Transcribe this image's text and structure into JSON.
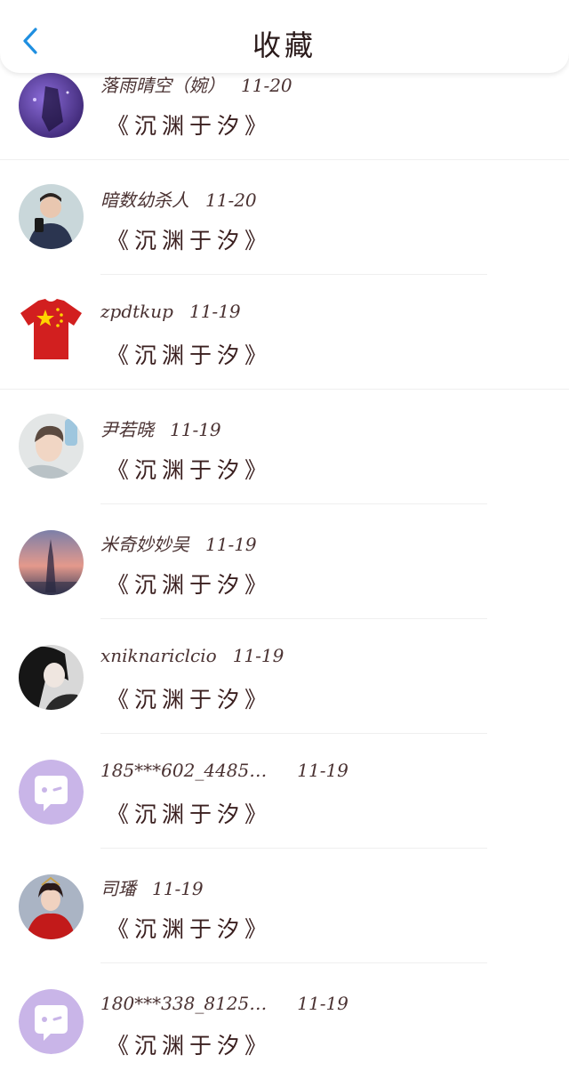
{
  "header": {
    "title": "收藏"
  },
  "items": [
    {
      "name": "落雨晴空（婉）",
      "date": "11-20",
      "work": "《沉渊于汐》",
      "avatar": "photo"
    },
    {
      "name": "暗数幼杀人",
      "date": "11-20",
      "work": "《沉渊于汐》",
      "avatar": "photo"
    },
    {
      "name": "zpdtkup",
      "date": "11-19",
      "work": "《沉渊于汐》",
      "avatar": "flag-shirt"
    },
    {
      "name": "尹若晓",
      "date": "11-19",
      "work": "《沉渊于汐》",
      "avatar": "photo"
    },
    {
      "name": "米奇妙妙吴",
      "date": "11-19",
      "work": "《沉渊于汐》",
      "avatar": "photo"
    },
    {
      "name": "xniknariclcio",
      "date": "11-19",
      "work": "《沉渊于汐》",
      "avatar": "photo"
    },
    {
      "name": "185***602_4485…",
      "date": "11-19",
      "work": "《沉渊于汐》",
      "avatar": "default"
    },
    {
      "name": "司璠",
      "date": "11-19",
      "work": "《沉渊于汐》",
      "avatar": "photo"
    },
    {
      "name": "180***338_8125…",
      "date": "11-19",
      "work": "《沉渊于汐》",
      "avatar": "default"
    }
  ],
  "colors": {
    "accent": "#1f8fe0",
    "default_avatar": "#c9b5e8"
  }
}
